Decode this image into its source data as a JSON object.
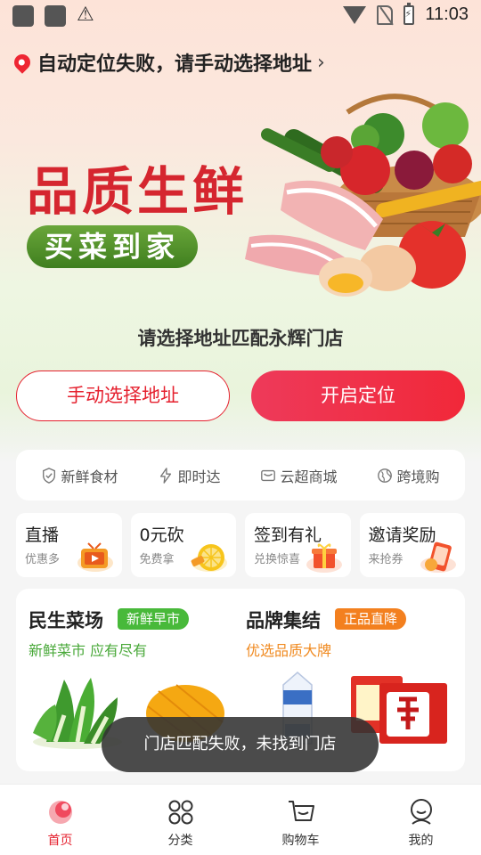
{
  "status_bar": {
    "time": "11:03"
  },
  "location": {
    "text": "自动定位失败，请手动选择地址",
    "chevron": "›"
  },
  "banner": {
    "title": "品质生鲜",
    "pill": "买菜到家"
  },
  "prompt": "请选择地址匹配永辉门店",
  "buttons": {
    "manual": "手动选择地址",
    "locate": "开启定位"
  },
  "features": [
    {
      "label": "新鲜食材",
      "icon": "shield-icon"
    },
    {
      "label": "即时达",
      "icon": "lightning-icon"
    },
    {
      "label": "云超商城",
      "icon": "mail-icon"
    },
    {
      "label": "跨境购",
      "icon": "globe-icon"
    }
  ],
  "cards": [
    {
      "title": "直播",
      "sub": "优惠多",
      "icon": "tv-icon"
    },
    {
      "title": "0元砍",
      "sub": "免费拿",
      "icon": "lemon-icon"
    },
    {
      "title": "签到有礼",
      "sub": "兑换惊喜",
      "icon": "gift-icon"
    },
    {
      "title": "邀请奖励",
      "sub": "来抢券",
      "icon": "phone-icon"
    }
  ],
  "section": {
    "left": {
      "title": "民生菜场",
      "tag": "新鲜早市",
      "sub": "新鲜菜市 应有尽有"
    },
    "right": {
      "title": "品牌集结",
      "tag": "正品直降",
      "sub": "优选品质大牌"
    }
  },
  "toast": "门店匹配失败，未找到门店",
  "tabs": [
    {
      "label": "首页",
      "icon": "home-icon",
      "active": true
    },
    {
      "label": "分类",
      "icon": "category-icon"
    },
    {
      "label": "购物车",
      "icon": "cart-icon"
    },
    {
      "label": "我的",
      "icon": "profile-icon"
    }
  ],
  "colors": {
    "brand_red": "#e5202e",
    "green": "#48b93a",
    "orange": "#f3801f"
  }
}
